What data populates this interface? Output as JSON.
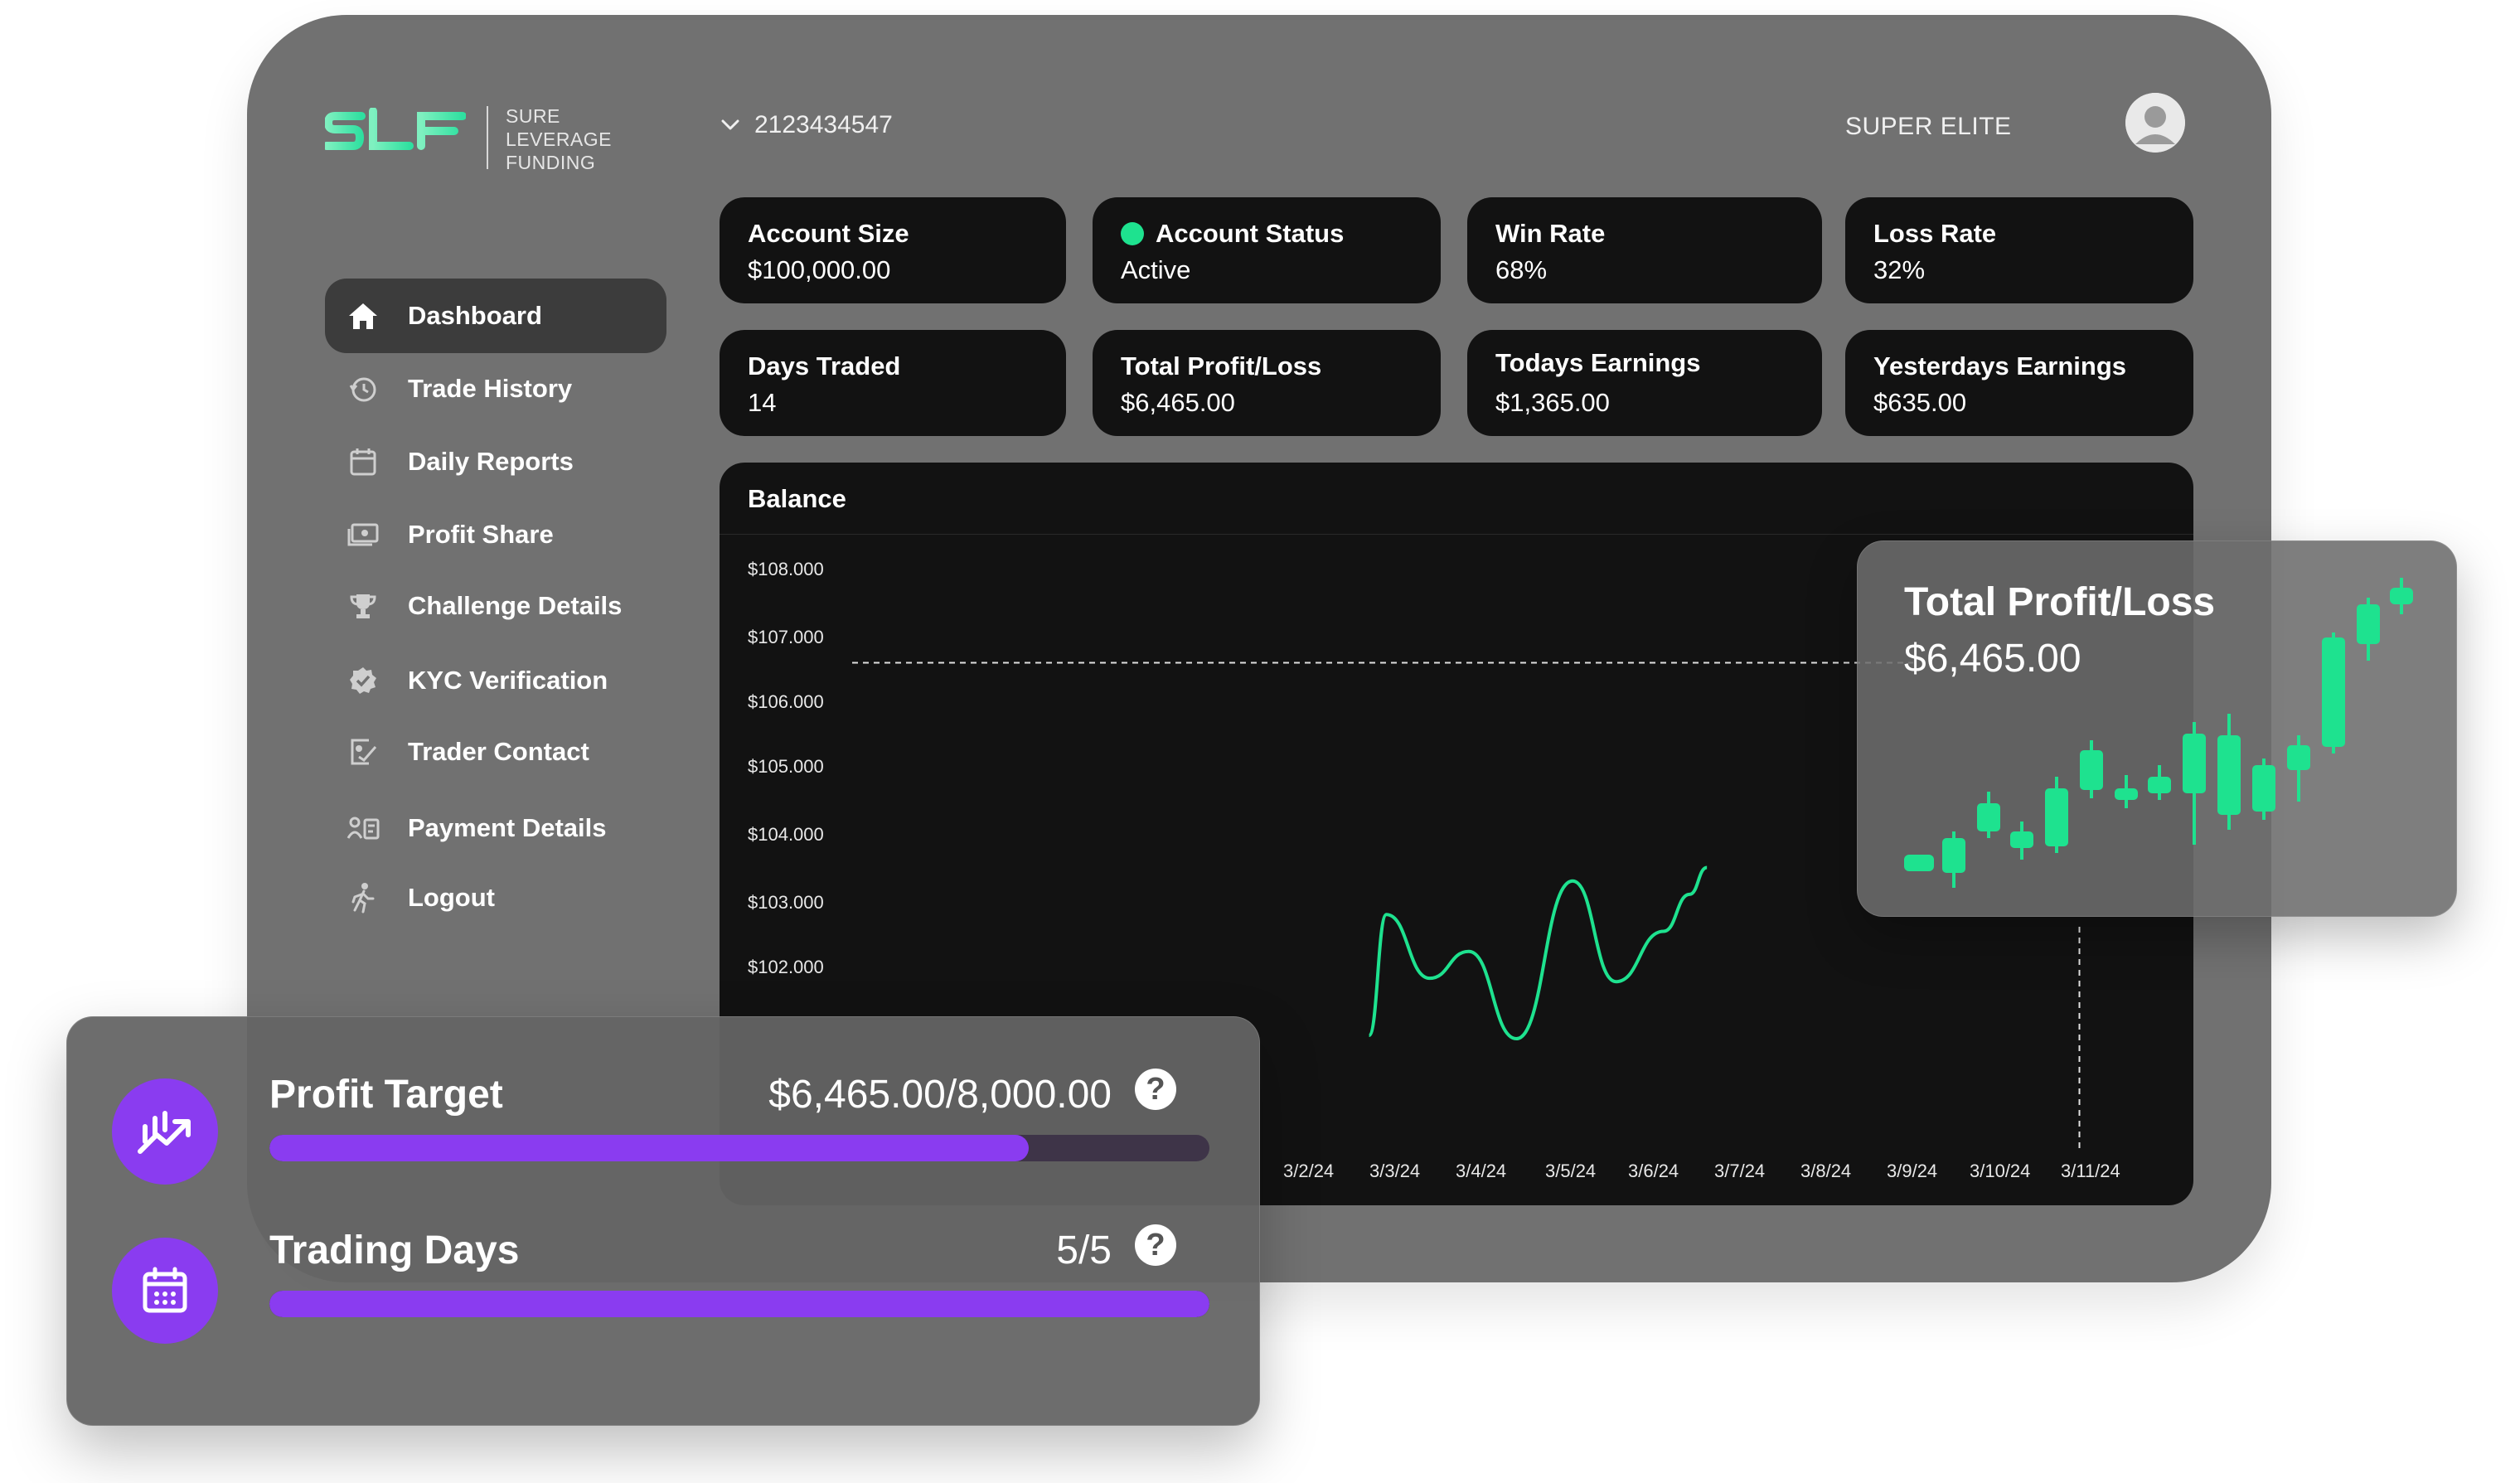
{
  "brand": {
    "mark": "SLF",
    "name_lines": [
      "SURE",
      "LEVERAGE",
      "FUNDING"
    ],
    "accent": "#3fe3a0"
  },
  "header": {
    "account_number": "2123434547",
    "tier": "SUPER ELITE"
  },
  "sidebar": {
    "items": [
      {
        "label": "Dashboard",
        "icon": "home-icon",
        "active": true
      },
      {
        "label": "Trade History",
        "icon": "history-icon",
        "active": false
      },
      {
        "label": "Daily Reports",
        "icon": "calendar-icon",
        "active": false
      },
      {
        "label": "Profit Share",
        "icon": "cash-icon",
        "active": false
      },
      {
        "label": "Challenge Details",
        "icon": "trophy-icon",
        "active": false
      },
      {
        "label": "KYC Verification",
        "icon": "verified-badge-icon",
        "active": false
      },
      {
        "label": "Trader Contact",
        "icon": "contact-icon",
        "active": false
      },
      {
        "label": "Payment Details",
        "icon": "payment-icon",
        "active": false
      },
      {
        "label": "Logout",
        "icon": "logout-icon",
        "active": false
      }
    ]
  },
  "stats": [
    {
      "title": "Account Size",
      "value": "$100,000.00"
    },
    {
      "title": "Account Status",
      "value": "Active",
      "status_color": "#1ee28f"
    },
    {
      "title": "Win Rate",
      "value": "68%"
    },
    {
      "title": "Loss Rate",
      "value": "32%"
    },
    {
      "title": "Days Traded",
      "value": "14"
    },
    {
      "title": "Total Profit/Loss",
      "value": "$6,465.00"
    },
    {
      "title": "Todays Earnings",
      "value": "$1,365.00"
    },
    {
      "title": "Yesterdays Earnings",
      "value": "$635.00"
    }
  ],
  "chart_data": {
    "type": "line",
    "title": "Balance",
    "y_ticks": [
      "$108.000",
      "$107.000",
      "$106.000",
      "$105.000",
      "$104.000",
      "$103.000",
      "$102.000"
    ],
    "x_ticks": [
      "3/2/24",
      "3/3/24",
      "3/4/24",
      "3/5/24",
      "3/6/24",
      "3/7/24",
      "3/8/24",
      "3/9/24",
      "3/10/24",
      "3/11/24"
    ],
    "ylim": [
      101000,
      108000
    ],
    "target_line": 106550,
    "line_color": "#1ee28f",
    "series": [
      {
        "points": [
          [
            0.8,
            101000
          ],
          [
            1.0,
            102800
          ],
          [
            1.5,
            101850
          ],
          [
            1.95,
            102250
          ],
          [
            2.5,
            100950
          ],
          [
            3.15,
            103300
          ],
          [
            3.65,
            101800
          ],
          [
            4.2,
            102550
          ],
          [
            4.5,
            103100
          ],
          [
            4.7,
            103500
          ]
        ]
      }
    ]
  },
  "pl_card": {
    "title": "Total Profit/Loss",
    "value": "$6,465.00",
    "candle_color": "#1ee28f"
  },
  "targets": [
    {
      "label": "Profit Target",
      "value": "$6,465.00/8,000.00",
      "progress": 0.808,
      "icon": "growth-chart-icon"
    },
    {
      "label": "Trading Days",
      "value": "5/5",
      "progress": 1.0,
      "icon": "calendar-icon"
    }
  ],
  "help_glyph": "?"
}
